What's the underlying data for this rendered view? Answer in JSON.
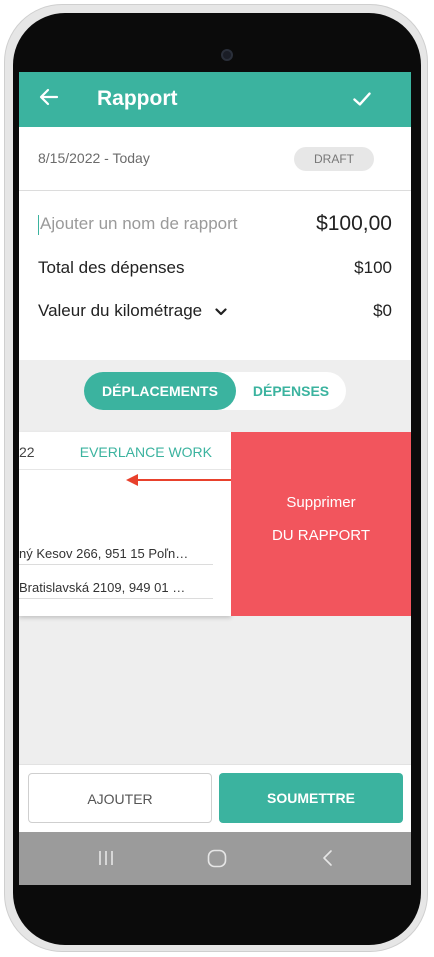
{
  "app_bar": {
    "title": "Rapport",
    "back_icon": "arrow-left-icon",
    "confirm_icon": "check-icon",
    "color": "#3bb39f"
  },
  "report": {
    "date_range": "8/15/2022 - Today",
    "status_badge": "DRAFT",
    "name_placeholder": "Ajouter un nom de rapport",
    "total_amount": "$100,00",
    "expenses_label": "Total des dépenses",
    "expenses_value": "$100",
    "mileage_label": "Valeur du kilométrage",
    "mileage_value": "$0"
  },
  "segment": {
    "active": "DÉPLACEMENTS",
    "inactive": "DÉPENSES"
  },
  "trip_card": {
    "date_fragment": "22",
    "tag": "EVERLANCE WORK",
    "from_address": "ný Kesov 266, 951 15 Poľn…",
    "to_address": "Bratislavská 2109, 949 01 …"
  },
  "delete_action": {
    "line1": "Supprimer",
    "line2": "DU RAPPORT",
    "color": "#f2555d"
  },
  "buttons": {
    "add": "AJOUTER",
    "submit": "SOUMETTRE"
  },
  "nav_bar": {
    "recent_icon": "recent-apps-icon",
    "home_icon": "home-icon",
    "back_icon": "back-icon"
  }
}
